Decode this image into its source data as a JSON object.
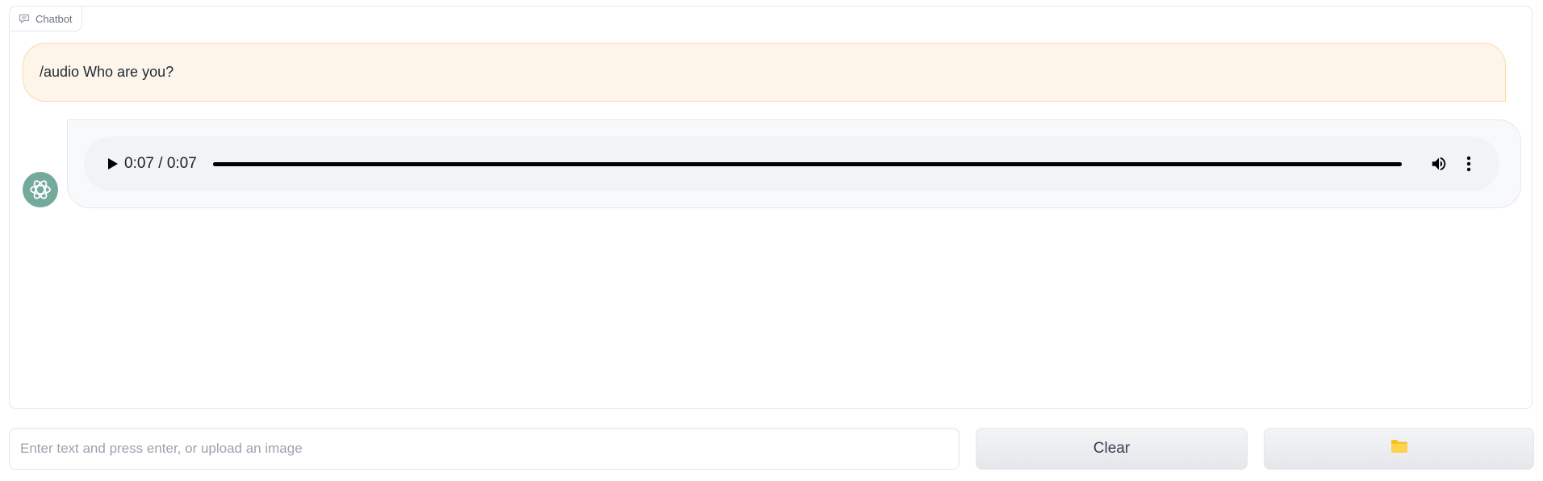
{
  "chatbot": {
    "label": "Chatbot",
    "messages": [
      {
        "role": "user",
        "text": "/audio Who are you?"
      },
      {
        "role": "bot",
        "type": "audio",
        "time_display": "0:07 / 0:07",
        "progress_fraction": 1.0
      }
    ]
  },
  "input": {
    "placeholder": "Enter text and press enter, or upload an image",
    "value": ""
  },
  "buttons": {
    "clear_label": "Clear",
    "upload_icon": "folder-icon"
  },
  "colors": {
    "user_bubble_bg": "#fef5ea",
    "user_bubble_border": "#fcd9a8",
    "bot_avatar": "#74aa9c",
    "folder": "#fbbf24"
  }
}
